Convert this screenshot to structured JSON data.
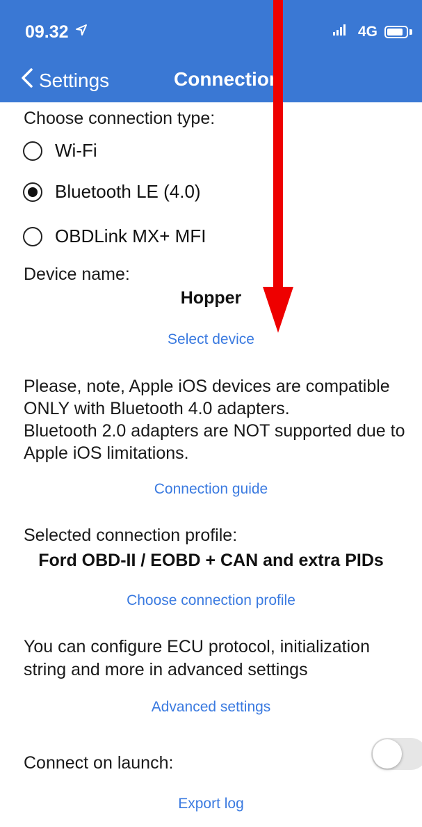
{
  "status": {
    "time": "09.32",
    "signal": "4G"
  },
  "nav": {
    "back_label": "Settings",
    "title": "Connection"
  },
  "connection_type": {
    "heading": "Choose connection type:",
    "options": [
      {
        "label": "Wi-Fi",
        "selected": false
      },
      {
        "label": "Bluetooth LE (4.0)",
        "selected": true
      },
      {
        "label": "OBDLink MX+ MFI",
        "selected": false
      }
    ]
  },
  "device": {
    "label": "Device name:",
    "name": "Hopper",
    "select_link": "Select device"
  },
  "note": {
    "line1": "Please, note, Apple iOS devices are compatible",
    "line2": "ONLY with Bluetooth 4.0 adapters.",
    "line3": "Bluetooth 2.0 adapters are NOT supported due to",
    "line4": "Apple iOS limitations."
  },
  "guide_link": "Connection guide",
  "profile": {
    "label": "Selected connection profile:",
    "name": "Ford OBD-II / EOBD + CAN and extra PIDs",
    "choose_link": "Choose connection profile"
  },
  "advanced": {
    "line1": "You can configure ECU protocol, initialization",
    "line2": "string and more in advanced settings",
    "link": "Advanced settings"
  },
  "launch": {
    "label": "Connect on launch:",
    "enabled": false
  },
  "export_link": "Export log",
  "colors": {
    "header": "#3a78d4",
    "link": "#3a7ae0",
    "annotation_arrow": "#ee0000"
  }
}
